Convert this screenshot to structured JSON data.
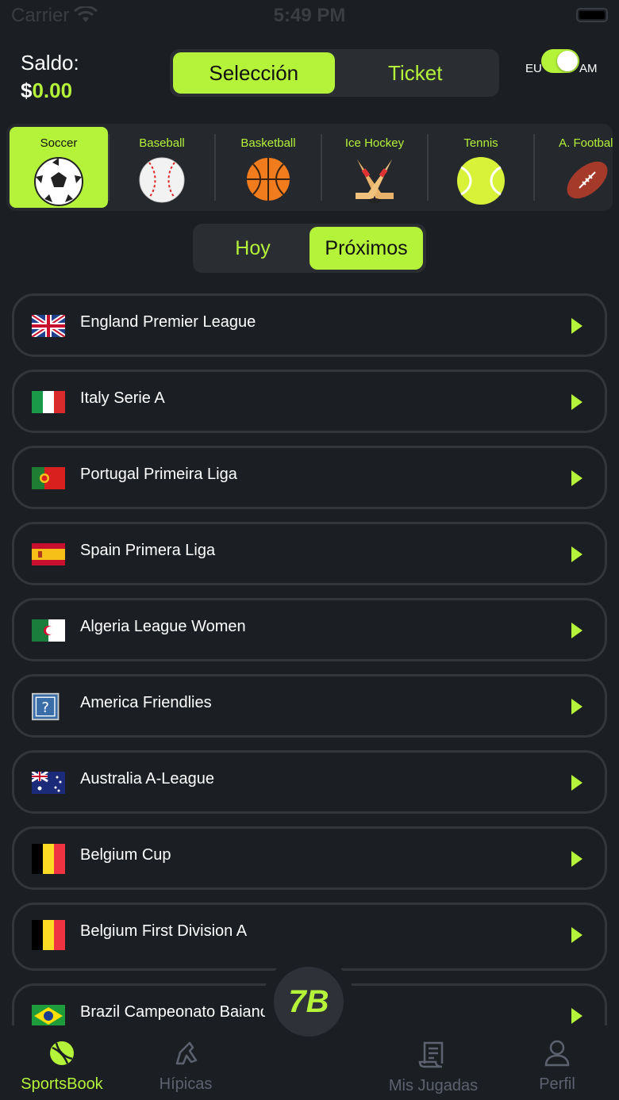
{
  "status_bar": {
    "carrier": "Carrier",
    "time": "5:49 PM"
  },
  "header": {
    "saldo_label": "Saldo:",
    "saldo_currency": "$",
    "saldo_amount": "0.00",
    "tabs": [
      {
        "label": "Selección",
        "active": true
      },
      {
        "label": "Ticket",
        "active": false
      }
    ],
    "toggle": {
      "left_label": "EU",
      "right_label": "AM",
      "on": true
    }
  },
  "sports": [
    {
      "label": "Soccer",
      "icon": "soccer-ball-icon",
      "active": true
    },
    {
      "label": "Baseball",
      "icon": "baseball-icon",
      "active": false
    },
    {
      "label": "Basketball",
      "icon": "basketball-icon",
      "active": false
    },
    {
      "label": "Ice Hockey",
      "icon": "hockey-sticks-icon",
      "active": false
    },
    {
      "label": "Tennis",
      "icon": "tennis-ball-icon",
      "active": false
    },
    {
      "label": "A. Football",
      "icon": "american-football-icon",
      "active": false
    }
  ],
  "date_tabs": [
    {
      "label": "Hoy",
      "active": false
    },
    {
      "label": "Próximos",
      "active": true
    }
  ],
  "leagues": [
    {
      "name": "England Premier League",
      "flag": "uk-flag-icon"
    },
    {
      "name": "Italy Serie A",
      "flag": "italy-flag-icon"
    },
    {
      "name": "Portugal Primeira Liga",
      "flag": "portugal-flag-icon"
    },
    {
      "name": "Spain Primera Liga",
      "flag": "spain-flag-icon"
    },
    {
      "name": "Algeria League Women",
      "flag": "algeria-flag-icon"
    },
    {
      "name": "America Friendlies",
      "flag": "unknown-flag-icon"
    },
    {
      "name": "Australia A-League",
      "flag": "australia-flag-icon"
    },
    {
      "name": "Belgium Cup",
      "flag": "belgium-flag-icon"
    },
    {
      "name": "Belgium First Division A",
      "flag": "belgium-flag-icon"
    },
    {
      "name": "Brazil Campeonato Baiano",
      "flag": "brazil-flag-icon"
    }
  ],
  "bottom_nav": [
    {
      "label": "SportsBook",
      "icon": "sportsbook-icon",
      "active": true
    },
    {
      "label": "Hípicas",
      "icon": "horse-racing-icon",
      "active": false
    },
    {
      "label": "Mis Jugadas",
      "icon": "receipt-icon",
      "active": false
    },
    {
      "label": "Perfil",
      "icon": "user-icon",
      "active": false
    }
  ],
  "center_button": {
    "label": "7B"
  },
  "colors": {
    "accent": "#b5f33a",
    "background": "#1b1e22",
    "card_border": "#33363b"
  }
}
